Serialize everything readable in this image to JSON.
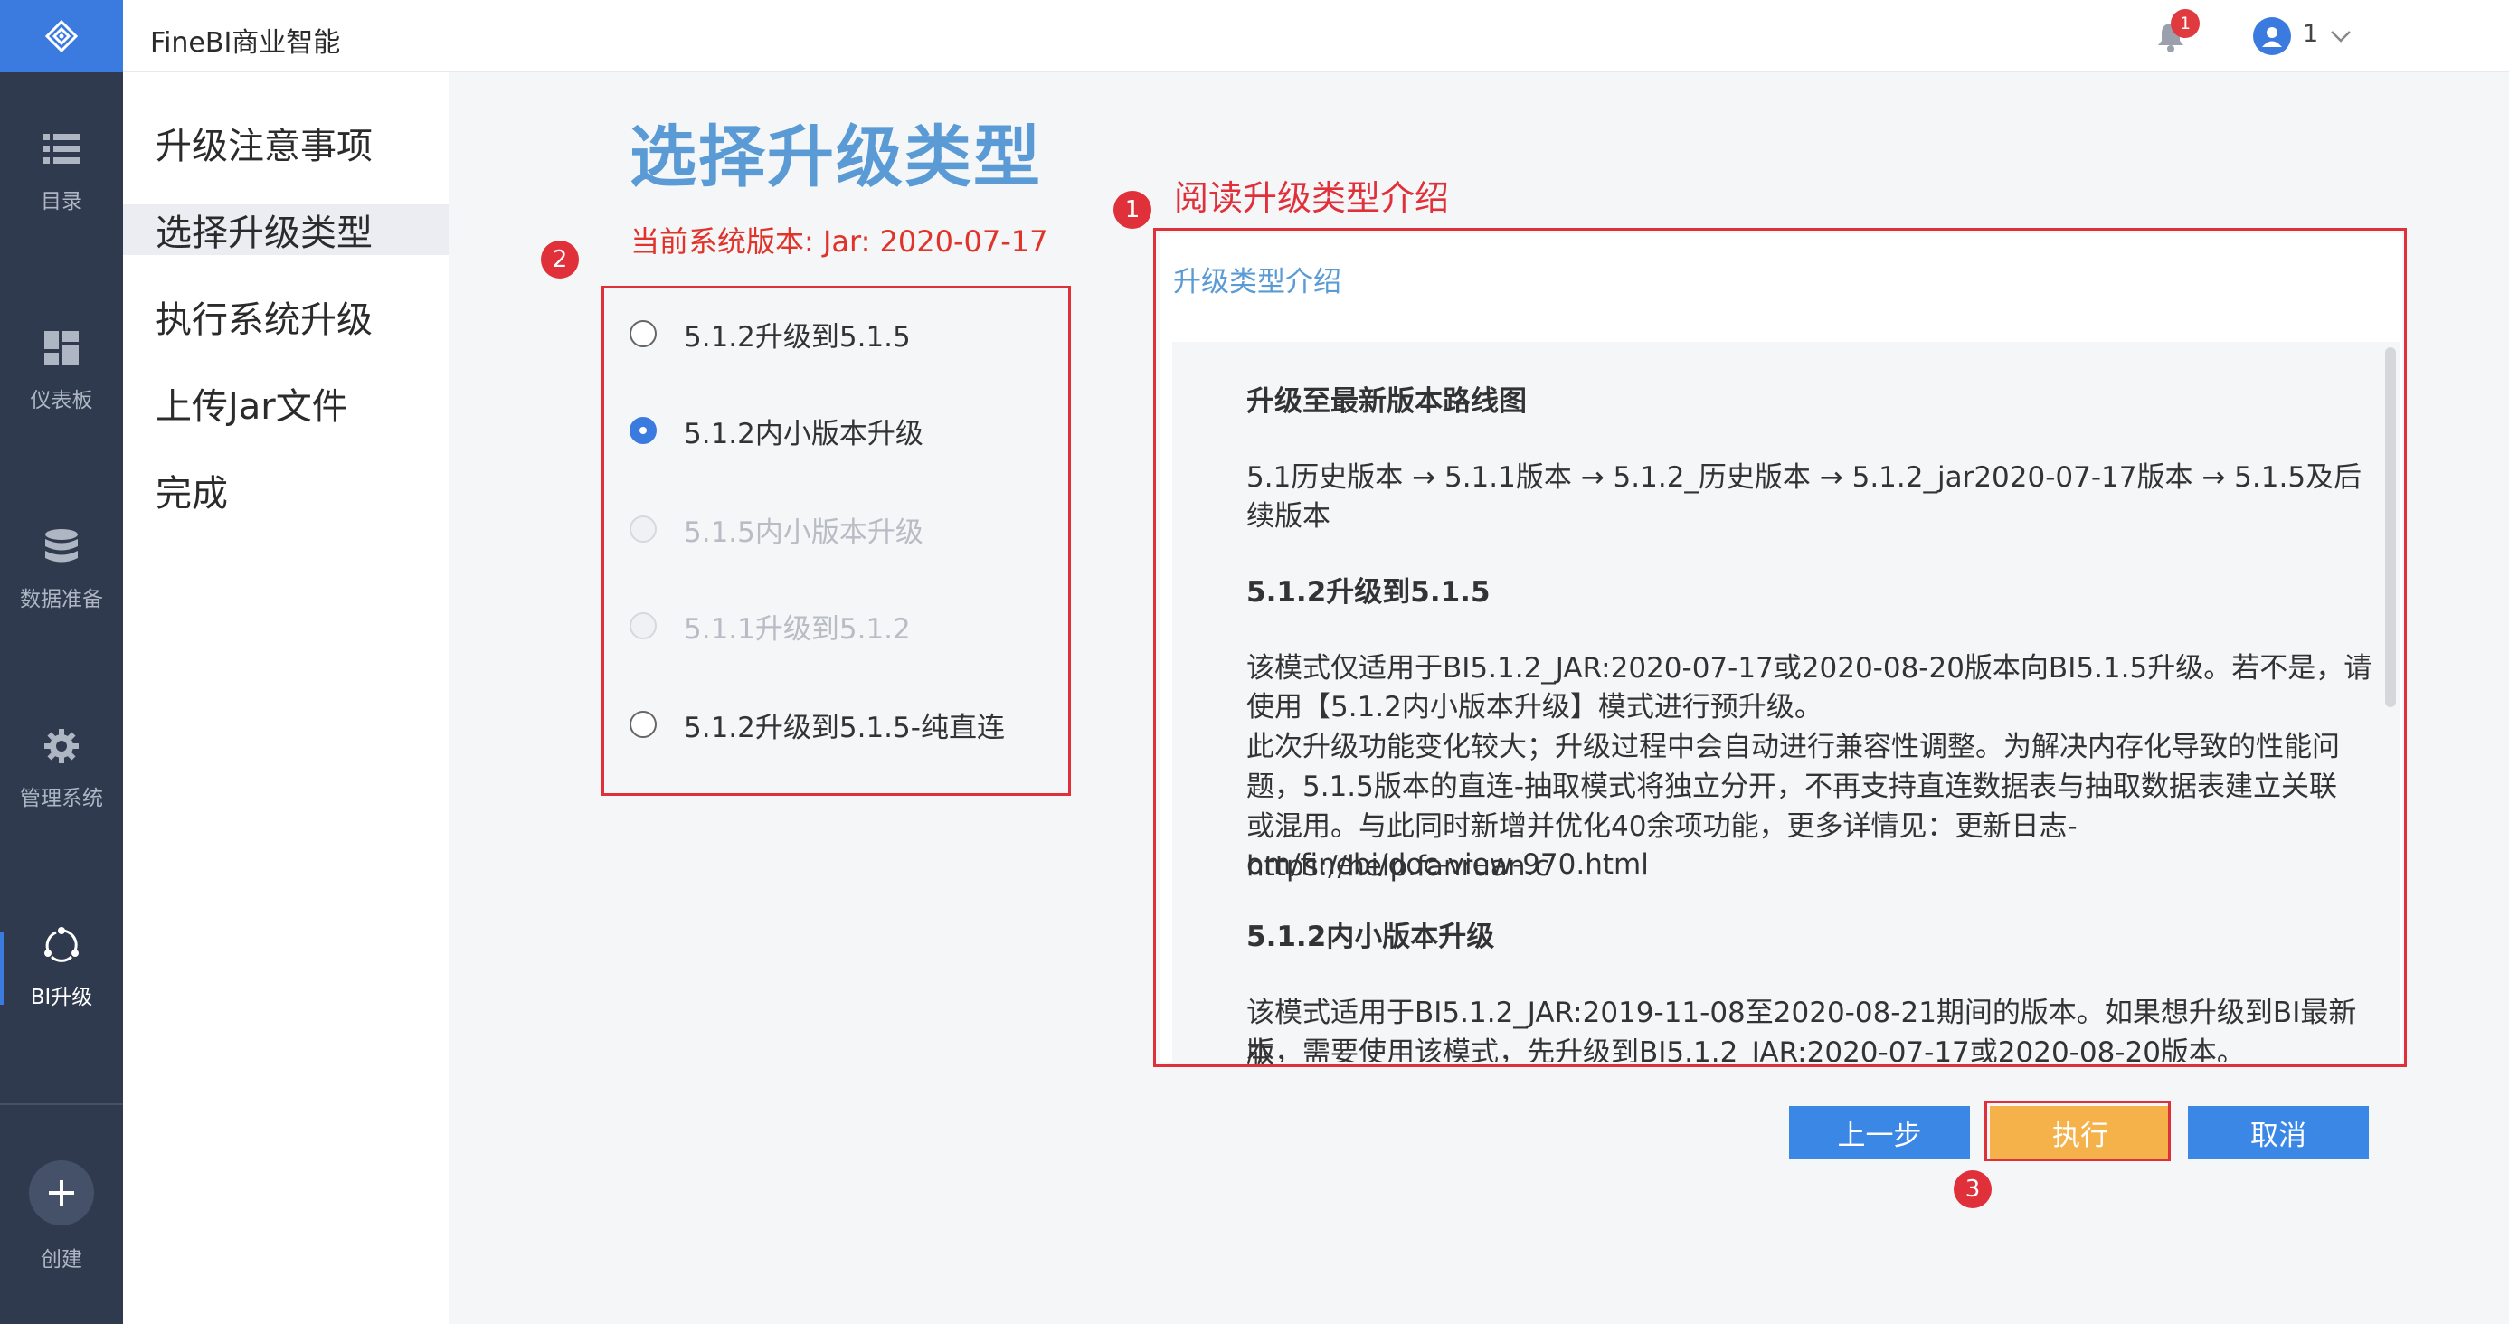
{
  "app": {
    "title": "FineBI商业智能"
  },
  "rail": {
    "items": [
      {
        "label": "目录",
        "icon": "list-icon"
      },
      {
        "label": "仪表板",
        "icon": "dashboard-icon"
      },
      {
        "label": "数据准备",
        "icon": "database-icon"
      },
      {
        "label": "管理系统",
        "icon": "gear-icon"
      },
      {
        "label": "BI升级",
        "icon": "upgrade-icon",
        "active": true
      }
    ],
    "create_label": "创建"
  },
  "header": {
    "notification_count": "1",
    "user_name": "1"
  },
  "steps": [
    {
      "label": "升级注意事项"
    },
    {
      "label": "选择升级类型",
      "active": true
    },
    {
      "label": "执行系统升级"
    },
    {
      "label": "上传Jar文件"
    },
    {
      "label": "完成"
    }
  ],
  "main": {
    "title": "选择升级类型",
    "version_text": "当前系统版本:   Jar: 2020-07-17",
    "read_label": "阅读升级类型介绍",
    "options": [
      {
        "label": "5.1.2升级到5.1.5",
        "state": "normal"
      },
      {
        "label": "5.1.2内小版本升级",
        "state": "selected"
      },
      {
        "label": "5.1.5内小版本升级",
        "state": "disabled"
      },
      {
        "label": "5.1.1升级到5.1.2",
        "state": "disabled"
      },
      {
        "label": "5.1.2升级到5.1.5-纯直连",
        "state": "normal"
      }
    ]
  },
  "intro": {
    "title": "升级类型介绍",
    "h1": "升级至最新版本路线图",
    "p1_line1": "5.1历史版本 →  5.1.1版本  →  5.1.2_历史版本 →  5.1.2_jar2020-07-17版本 → 5.1.5及后",
    "p1_line2": "续版本",
    "h2": "5.1.2升级到5.1.5",
    "p2_line1": "该模式仅适用于BI5.1.2_JAR:2020-07-17或2020-08-20版本向BI5.1.5升级。若不是，请",
    "p2_line2": "使用【5.1.2内小版本升级】模式进行预升级。",
    "p3_line1": "此次升级功能变化较大；升级过程中会自动进行兼容性调整。为解决内存化导致的性能问",
    "p3_line2": "题，5.1.5版本的直连-抽取模式将独立分开，不再支持直连数据表与抽取数据表建立关联",
    "p3_line3": "或混用。与此同时新增并优化40余项功能，更多详情见：更新日志-https://help.fanruan.c",
    "p3_line4": "om/finebi/doc-view-970.html",
    "h3": "5.1.2内小版本升级",
    "p4_line1": "该模式适用于BI5.1.2_JAR:2019-11-08至2020-08-21期间的版本。如果想升级到BI最新版",
    "p4_line2": "本，需要使用该模式，先升级到BI5.1.2_JAR:2020-07-17或2020-08-20版本。"
  },
  "buttons": {
    "prev": "上一步",
    "exec": "执行",
    "cancel": "取消"
  },
  "markers": {
    "m1": "1",
    "m2": "2",
    "m3": "3"
  },
  "colors": {
    "accent": "#3b7be0",
    "annotation_red": "#e0303a",
    "exec_orange": "#f5b24b",
    "title_blue": "#5b9bd5"
  }
}
